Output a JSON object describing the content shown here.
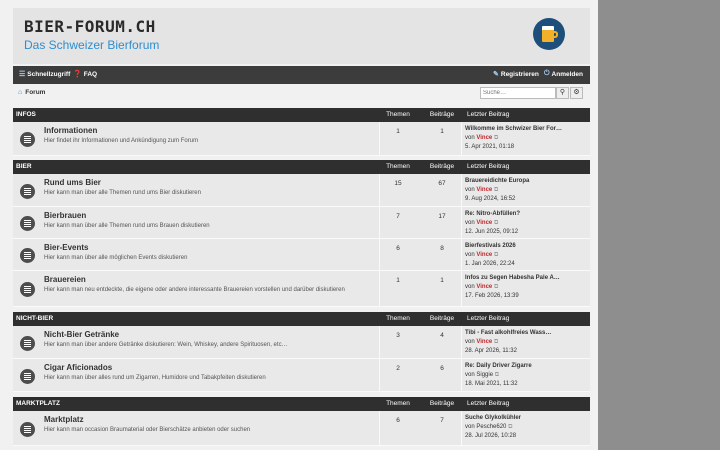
{
  "header": {
    "site_title": "BIER-FORUM.CH",
    "site_subtitle": "Das Schweizer Bierforum",
    "logo_icon": "beer-mug-icon"
  },
  "navbar": {
    "quicklinks": "Schnellzugriff",
    "faq": "FAQ",
    "register": "Registrieren",
    "login": "Anmelden"
  },
  "breadcrumb": {
    "label": "Forum"
  },
  "search": {
    "placeholder": "Suche…"
  },
  "columns": {
    "topics": "Themen",
    "posts": "Beiträge",
    "last": "Letzter Beitrag"
  },
  "by": "von",
  "categories": [
    {
      "name": "INFOS",
      "forums": [
        {
          "title": "Informationen",
          "desc": "Hier findet ihr Informationen und Ankündigung zum Forum",
          "topics": "1",
          "posts": "1",
          "last_title": "Wilkomme im Schwizer Bier For…",
          "last_author": "Vince",
          "last_date": "5. Apr 2021, 01:18"
        }
      ]
    },
    {
      "name": "BIER",
      "forums": [
        {
          "title": "Rund ums Bier",
          "desc": "Hier kann man über alle Themen rund ums Bier diskutieren",
          "topics": "15",
          "posts": "67",
          "last_title": "Brauereidichte Europa",
          "last_author": "Vince",
          "last_date": "9. Aug 2024, 16:52"
        },
        {
          "title": "Bierbrauen",
          "desc": "Hier kann man über alle Themen rund ums Brauen diskutieren",
          "topics": "7",
          "posts": "17",
          "last_title": "Re: Nitro-Abfüllen?",
          "last_author": "Vince",
          "last_date": "12. Jun 2025, 09:12"
        },
        {
          "title": "Bier-Events",
          "desc": "Hier kann man über alle möglichen Events diskutieren",
          "topics": "6",
          "posts": "8",
          "last_title": "Bierfestivals 2026",
          "last_author": "Vince",
          "last_date": "1. Jan 2026, 22:24"
        },
        {
          "title": "Brauereien",
          "desc": "Hier kann man neu entdeckte, die eigene oder andere interessante Brauereien vorstellen und darüber diskutieren",
          "topics": "1",
          "posts": "1",
          "last_title": "Infos zu Segen Habesha Pale A…",
          "last_author": "Vince",
          "last_date": "17. Feb 2026, 13:39"
        }
      ]
    },
    {
      "name": "NICHT-BIER",
      "forums": [
        {
          "title": "Nicht-Bier Getränke",
          "desc": "Hier kann man über andere Getränke diskutieren: Wein, Whiskey, andere Spirituosen, etc…",
          "topics": "3",
          "posts": "4",
          "last_title": "Tibi - Fast alkohlfreies Wass…",
          "last_author": "Vince",
          "last_date": "28. Apr 2026, 11:32"
        },
        {
          "title": "Cigar Aficionados",
          "desc": "Hier kann man über alles rund um Zigarren, Humidore und Tabakpfeiten diskutieren",
          "topics": "2",
          "posts": "6",
          "last_title": "Re: Daily Driver Zigarre",
          "last_author": "Siggie",
          "last_date": "18. Mai 2021, 11:32"
        }
      ]
    },
    {
      "name": "MARKTPLATZ",
      "forums": [
        {
          "title": "Marktplatz",
          "desc": "Hier kann man occasion Braumaterial oder Bierschätze anbieten oder suchen",
          "topics": "6",
          "posts": "7",
          "last_title": "Suche Glykolkühler",
          "last_author": "Pesche620",
          "last_date": "28. Jul 2026, 10:28"
        }
      ]
    }
  ]
}
